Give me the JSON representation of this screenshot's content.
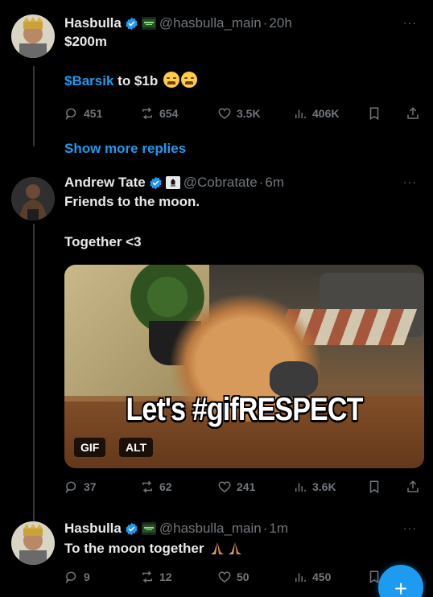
{
  "tweets": [
    {
      "name": "Hasbulla",
      "handle": "@hasbulla_main",
      "time": "20h",
      "line1": "$200m",
      "link": "$Barsik",
      "line2_rest": " to $1b",
      "stats": {
        "replies": "451",
        "reposts": "654",
        "likes": "3.5K",
        "views": "406K"
      }
    },
    {
      "name": "Andrew Tate",
      "handle": "@Cobratate",
      "time": "6m",
      "line1": "Friends to the moon.",
      "line2": "Together <3",
      "media": {
        "caption": "Let's #gifRESPECT",
        "gif_label": "GIF",
        "alt_label": "ALT"
      },
      "stats": {
        "replies": "37",
        "reposts": "62",
        "likes": "241",
        "views": "3.6K"
      }
    },
    {
      "name": "Hasbulla",
      "handle": "@hasbulla_main",
      "time": "1m",
      "line1": "To the moon together",
      "stats": {
        "replies": "9",
        "reposts": "12",
        "likes": "50",
        "views": "450"
      }
    }
  ],
  "show_more": "Show more replies",
  "separator": "·",
  "more_glyph": "···",
  "compose_glyph": "+",
  "colors": {
    "accent": "#1d9bf0",
    "muted": "#71767b",
    "background": "#000000"
  },
  "icons": [
    "verified-badge-icon",
    "reply-icon",
    "repost-icon",
    "like-icon",
    "views-icon",
    "bookmark-icon",
    "share-icon",
    "more-icon",
    "compose-icon"
  ]
}
